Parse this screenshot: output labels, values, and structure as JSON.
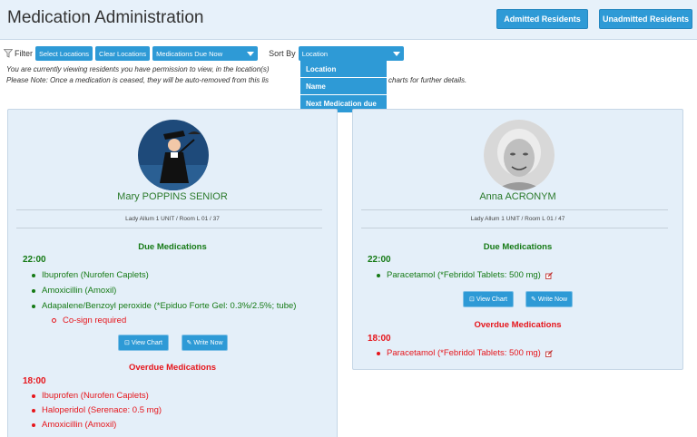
{
  "header": {
    "title": "Medication Administration",
    "admitted_label": "Admitted Residents",
    "unadmitted_label": "Unadmitted Residents"
  },
  "filter": {
    "label": "Filter",
    "select_locations": "Select Locations",
    "clear_locations": "Clear Locations",
    "view_select": "Medications Due Now",
    "sort_label": "Sort By",
    "sort_select": "Location",
    "sort_options": [
      "Location",
      "Name",
      "Next Medication due"
    ]
  },
  "info": {
    "line1_a": "You are currently viewing residents you have permission to view, in the location(s)",
    "line2_a": "Please Note: Once a medication is ceased, they will be auto-removed from this lis",
    "line2_b": "charts for further details."
  },
  "colors": {
    "accent": "#2e9ad6",
    "card_bg": "#e4eff9",
    "due_green": "#157a15",
    "overdue_red": "#e6151b"
  },
  "residents": [
    {
      "name": "Mary POPPINS SENIOR",
      "location": "Lady Allum 1 UNIT / Room L 01 / 37",
      "due_title": "Due Medications",
      "due_time": "22:00",
      "due_meds": [
        "Ibuprofen (Nurofen Caplets)",
        "Amoxicillin (Amoxil)",
        "Adapalene/Benzoyl peroxide (*Epiduo Forte Gel: 0.3%/2.5%; tube)"
      ],
      "cosign": "Co-sign required",
      "view_chart": "View Chart",
      "write_now": "Write Now",
      "overdue_title": "Overdue Medications",
      "overdue_time": "18:00",
      "overdue_meds": [
        "Ibuprofen (Nurofen Caplets)",
        "Haloperidol (Serenace: 0.5 mg)",
        "Amoxicillin (Amoxil)"
      ]
    },
    {
      "name": "Anna ACRONYM",
      "location": "Lady Allum 1 UNIT / Room L 01 / 47",
      "due_title": "Due Medications",
      "due_time": "22:00",
      "due_meds": [
        "Paracetamol (*Febridol Tablets: 500 mg)"
      ],
      "view_chart": "View Chart",
      "write_now": "Write Now",
      "overdue_title": "Overdue Medications",
      "overdue_time": "18:00",
      "overdue_meds": [
        "Paracetamol (*Febridol Tablets: 500 mg)"
      ]
    }
  ]
}
